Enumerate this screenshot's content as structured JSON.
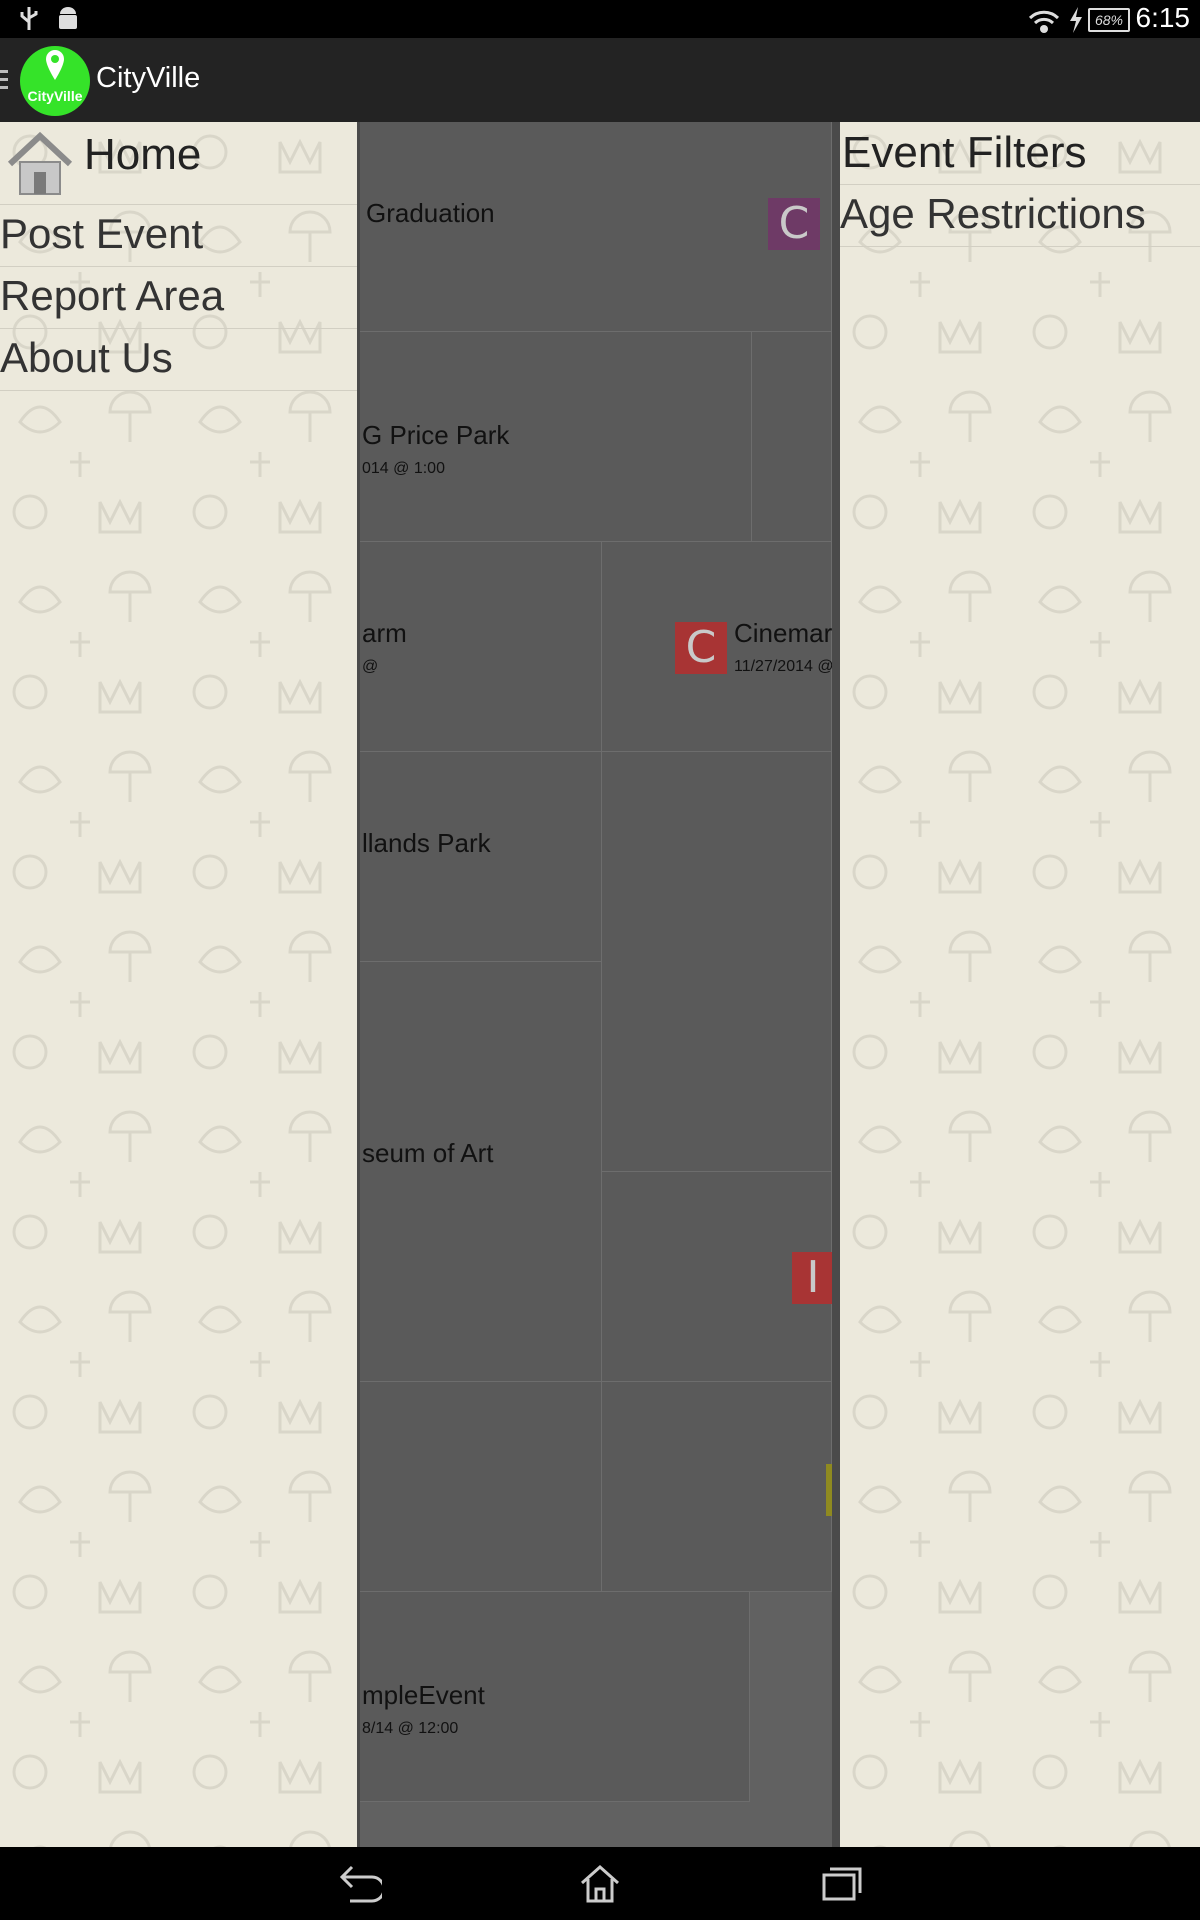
{
  "status_bar": {
    "battery": "68%",
    "time": "6:15",
    "icons": [
      "usb-icon",
      "android-icon",
      "wifi-icon",
      "charging-icon",
      "battery-icon"
    ]
  },
  "action_bar": {
    "title": "CityVille",
    "logo_text": "CityVille",
    "icons": [
      "menu-icon",
      "app-logo"
    ]
  },
  "left_drawer": {
    "home_label": "Home",
    "items": [
      "Post Event",
      "Report Area",
      "About Us"
    ]
  },
  "right_drawer": {
    "items": [
      "Event Filters",
      "Age Restrictions"
    ]
  },
  "events": [
    {
      "title": "Graduation",
      "date": ""
    },
    {
      "title": "G Price Park",
      "date": "014 @ 1:00"
    },
    {
      "title": "arm",
      "date": "@"
    },
    {
      "title": "Cinemark",
      "date": "11/27/2014 @"
    },
    {
      "title": "llands Park",
      "date": ""
    },
    {
      "title": "seum of Art",
      "date": ""
    },
    {
      "title": "mpleEvent",
      "date": "8/14 @ 12:00"
    }
  ],
  "category_letters": [
    "C",
    "C",
    "I"
  ],
  "colors": {
    "drawer_bg": "#ece9dc",
    "scrim": "#616161",
    "logo_green": "#35e329",
    "purple": "#6e3a66",
    "red": "#a83434",
    "green": "#3e7a3a",
    "yellow": "#8f8a20"
  },
  "nav_bar": {
    "icons": [
      "back-icon",
      "home-nav-icon",
      "recents-icon"
    ]
  }
}
